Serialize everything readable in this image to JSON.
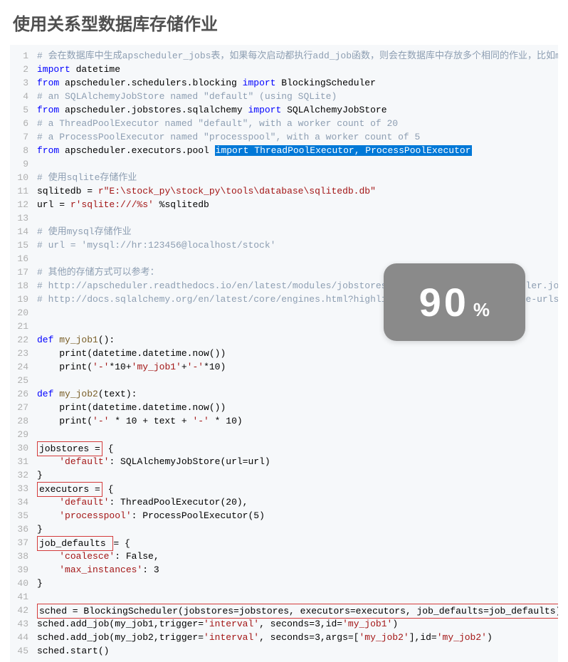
{
  "title": "使用关系型数据库存储作业",
  "overlay": {
    "value": "90",
    "unit": "%"
  },
  "lines": [
    {
      "n": 1,
      "segs": [
        {
          "cls": "c-com",
          "t": "# 会在数据库中生成apscheduler_jobs表，如果每次启动都执行add_job函数，则会在数据库中存放多个相同的作业，比如my_"
        }
      ]
    },
    {
      "n": 2,
      "segs": [
        {
          "cls": "c-kw",
          "t": "import"
        },
        {
          "t": " datetime"
        }
      ]
    },
    {
      "n": 3,
      "segs": [
        {
          "cls": "c-kw",
          "t": "from"
        },
        {
          "t": " apscheduler.schedulers.blocking "
        },
        {
          "cls": "c-kw",
          "t": "import"
        },
        {
          "t": " BlockingScheduler"
        }
      ]
    },
    {
      "n": 4,
      "segs": [
        {
          "cls": "c-com",
          "t": "# an SQLAlchemyJobStore named \"default\" (using SQLite)"
        }
      ]
    },
    {
      "n": 5,
      "segs": [
        {
          "cls": "c-kw",
          "t": "from"
        },
        {
          "t": " apscheduler.jobstores.sqlalchemy "
        },
        {
          "cls": "c-kw",
          "t": "import"
        },
        {
          "t": " SQLAlchemyJobStore"
        }
      ]
    },
    {
      "n": 6,
      "segs": [
        {
          "cls": "c-com",
          "t": "# a ThreadPoolExecutor named \"default\", with a worker count of 20"
        }
      ]
    },
    {
      "n": 7,
      "segs": [
        {
          "cls": "c-com",
          "t": "# a ProcessPoolExecutor named \"processpool\", with a worker count of 5"
        }
      ]
    },
    {
      "n": 8,
      "segs": [
        {
          "cls": "c-kw",
          "t": "from"
        },
        {
          "t": " apscheduler.executors.pool "
        },
        {
          "cls": "sel",
          "t": "import ThreadPoolExecutor, ProcessPoolExecutor"
        }
      ]
    },
    {
      "n": 9,
      "segs": []
    },
    {
      "n": 10,
      "segs": [
        {
          "cls": "c-com",
          "t": "# 使用sqlite存储作业"
        }
      ]
    },
    {
      "n": 11,
      "segs": [
        {
          "t": "sqlitedb = "
        },
        {
          "cls": "c-rstr",
          "t": "r\"E:\\stock_py\\stock_py\\tools\\database\\sqlitedb.db\""
        }
      ]
    },
    {
      "n": 12,
      "segs": [
        {
          "t": "url = "
        },
        {
          "cls": "c-rstr",
          "t": "r'sqlite:///%s'"
        },
        {
          "t": " %sqlitedb"
        }
      ]
    },
    {
      "n": 13,
      "segs": []
    },
    {
      "n": 14,
      "segs": [
        {
          "cls": "c-com",
          "t": "# 使用mysql存储作业"
        }
      ]
    },
    {
      "n": 15,
      "segs": [
        {
          "cls": "c-com",
          "t": "# url = 'mysql://hr:123456@localhost/stock'"
        }
      ]
    },
    {
      "n": 16,
      "segs": []
    },
    {
      "n": 17,
      "segs": [
        {
          "cls": "c-com",
          "t": "# 其他的存储方式可以参考："
        }
      ]
    },
    {
      "n": 18,
      "segs": [
        {
          "cls": "c-com",
          "t": "# http://apscheduler.readthedocs.io/en/latest/modules/jobstores/sqlalchemy.html#apscheduler.jobstores.s"
        }
      ]
    },
    {
      "n": 19,
      "segs": [
        {
          "cls": "c-com",
          "t": "# http://docs.sqlalchemy.org/en/latest/core/engines.html?highlight=create_engine#database-urls"
        }
      ]
    },
    {
      "n": 20,
      "segs": []
    },
    {
      "n": 21,
      "segs": []
    },
    {
      "n": 22,
      "segs": [
        {
          "cls": "c-kw",
          "t": "def"
        },
        {
          "t": " "
        },
        {
          "cls": "c-fn",
          "t": "my_job1"
        },
        {
          "t": "():"
        }
      ]
    },
    {
      "n": 23,
      "segs": [
        {
          "t": "    print(datetime.datetime.now())"
        }
      ]
    },
    {
      "n": 24,
      "segs": [
        {
          "t": "    print("
        },
        {
          "cls": "c-str",
          "t": "'-'"
        },
        {
          "t": "*10+"
        },
        {
          "cls": "c-str",
          "t": "'my_job1'"
        },
        {
          "t": "+"
        },
        {
          "cls": "c-str",
          "t": "'-'"
        },
        {
          "t": "*10)"
        }
      ]
    },
    {
      "n": 25,
      "segs": []
    },
    {
      "n": 26,
      "segs": [
        {
          "cls": "c-kw",
          "t": "def"
        },
        {
          "t": " "
        },
        {
          "cls": "c-fn",
          "t": "my_job2"
        },
        {
          "t": "(text):"
        }
      ]
    },
    {
      "n": 27,
      "segs": [
        {
          "t": "    print(datetime.datetime.now())"
        }
      ]
    },
    {
      "n": 28,
      "segs": [
        {
          "t": "    print("
        },
        {
          "cls": "c-str",
          "t": "'-'"
        },
        {
          "t": " * 10 + text + "
        },
        {
          "cls": "c-str",
          "t": "'-'"
        },
        {
          "t": " * 10)"
        }
      ]
    },
    {
      "n": 29,
      "segs": []
    },
    {
      "n": 30,
      "box": true,
      "boxText": "jobstores =",
      "segs": [
        {
          "t": " {"
        }
      ]
    },
    {
      "n": 31,
      "segs": [
        {
          "t": "    "
        },
        {
          "cls": "c-str",
          "t": "'default'"
        },
        {
          "t": ": SQLAlchemyJobStore(url=url)"
        }
      ]
    },
    {
      "n": 32,
      "segs": [
        {
          "t": "}"
        }
      ]
    },
    {
      "n": 33,
      "box": true,
      "boxText": "executors =",
      "segs": [
        {
          "t": " {"
        }
      ]
    },
    {
      "n": 34,
      "segs": [
        {
          "t": "    "
        },
        {
          "cls": "c-str",
          "t": "'default'"
        },
        {
          "t": ": ThreadPoolExecutor(20),"
        }
      ]
    },
    {
      "n": 35,
      "segs": [
        {
          "t": "    "
        },
        {
          "cls": "c-str",
          "t": "'processpool'"
        },
        {
          "t": ": ProcessPoolExecutor(5)"
        }
      ]
    },
    {
      "n": 36,
      "segs": [
        {
          "t": "}"
        }
      ]
    },
    {
      "n": 37,
      "box": true,
      "boxText": "job_defaults ",
      "segs": [
        {
          "t": "= {"
        }
      ]
    },
    {
      "n": 38,
      "segs": [
        {
          "t": "    "
        },
        {
          "cls": "c-str",
          "t": "'coalesce'"
        },
        {
          "t": ": False,"
        }
      ]
    },
    {
      "n": 39,
      "segs": [
        {
          "t": "    "
        },
        {
          "cls": "c-str",
          "t": "'max_instances'"
        },
        {
          "t": ": 3"
        }
      ]
    },
    {
      "n": 40,
      "segs": [
        {
          "t": "}"
        }
      ]
    },
    {
      "n": 41,
      "segs": []
    },
    {
      "n": 42,
      "boxFull": true,
      "segs": [
        {
          "t": "sched = BlockingScheduler(jobstores=jobstores, executors=executors, job_defaults=job_defaults)"
        }
      ]
    },
    {
      "n": 43,
      "segs": [
        {
          "t": "sched.add_job(my_job1,trigger="
        },
        {
          "cls": "c-str",
          "t": "'interval'"
        },
        {
          "t": ", seconds=3,id="
        },
        {
          "cls": "c-str",
          "t": "'my_job1'"
        },
        {
          "t": ")"
        }
      ]
    },
    {
      "n": 44,
      "segs": [
        {
          "t": "sched.add_job(my_job2,trigger="
        },
        {
          "cls": "c-str",
          "t": "'interval'"
        },
        {
          "t": ", seconds=3,args=["
        },
        {
          "cls": "c-str",
          "t": "'my_job2'"
        },
        {
          "t": "],id="
        },
        {
          "cls": "c-str",
          "t": "'my_job2'"
        },
        {
          "t": ")"
        }
      ]
    },
    {
      "n": 45,
      "segs": [
        {
          "t": "sched.start()"
        }
      ]
    }
  ]
}
